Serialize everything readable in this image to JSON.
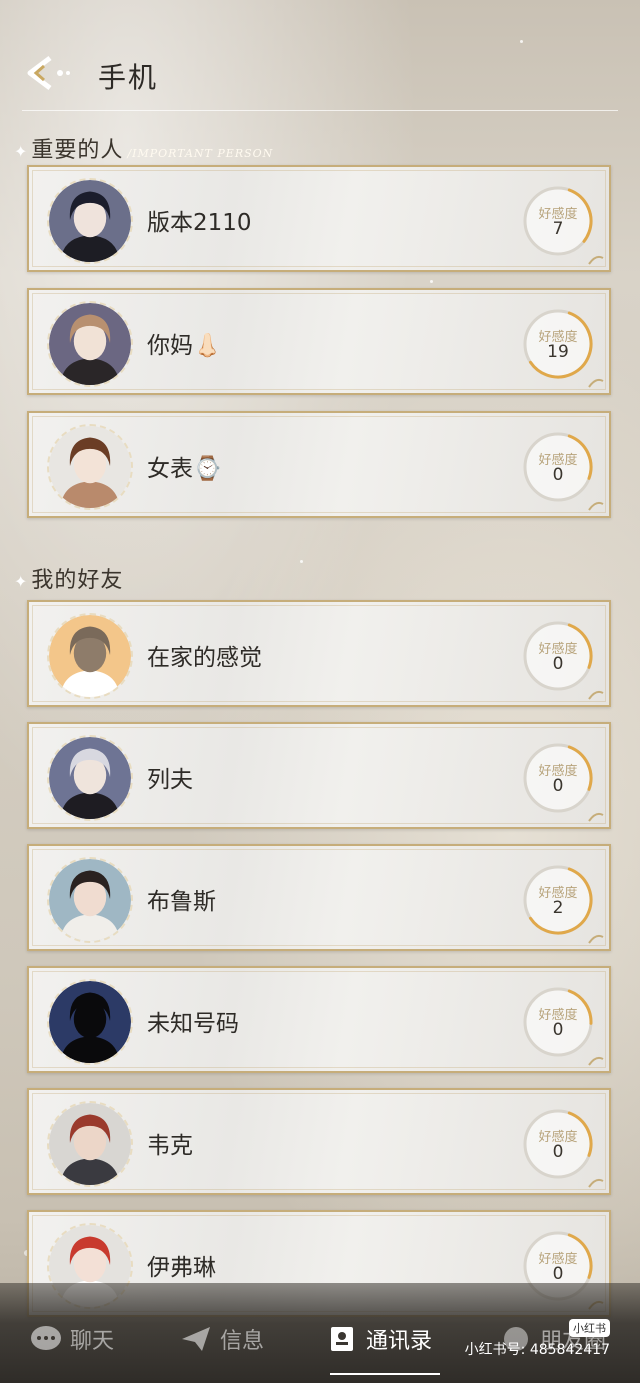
{
  "header": {
    "title": "手机"
  },
  "sections": {
    "important": {
      "title_zh": "重要的人",
      "title_en": "/IMPORTANT PERSON"
    },
    "friends": {
      "title_zh": "我的好友"
    }
  },
  "favor_label": "好感度",
  "contacts": [
    {
      "name": "版本2110",
      "favor": "7",
      "favor_fraction": 0.3,
      "avatar": "dark-haired-man",
      "section": "important"
    },
    {
      "name": "你妈👃🏻",
      "favor": "19",
      "favor_fraction": 0.6,
      "avatar": "long-haired-man",
      "section": "important"
    },
    {
      "name": "女表⌚",
      "favor": "0",
      "favor_fraction": 0.25,
      "avatar": "brown-haired-girl",
      "section": "important"
    },
    {
      "name": "在家的感觉",
      "favor": "0",
      "favor_fraction": 0.25,
      "avatar": "cat-with-sign",
      "section": "friends"
    },
    {
      "name": "列夫",
      "favor": "0",
      "favor_fraction": 0.25,
      "avatar": "silver-haired-man",
      "section": "friends"
    },
    {
      "name": "布鲁斯",
      "favor": "2",
      "favor_fraction": 0.6,
      "avatar": "dark-haired-boy",
      "section": "friends"
    },
    {
      "name": "未知号码",
      "favor": "0",
      "favor_fraction": 0.2,
      "avatar": "silhouette",
      "section": "friends"
    },
    {
      "name": "韦克",
      "favor": "0",
      "favor_fraction": 0.25,
      "avatar": "red-haired-man",
      "section": "friends"
    },
    {
      "name": "伊弗琳",
      "favor": "0",
      "favor_fraction": 0.25,
      "avatar": "red-haired-girl",
      "section": "friends"
    }
  ],
  "nav": {
    "chat": "聊天",
    "messages": "信息",
    "contacts": "通讯录",
    "moments": "朋友圈"
  },
  "watermark": {
    "badge": "小红书",
    "text": "小红书号: 485842417"
  },
  "colors": {
    "gold": "#c6ad7a",
    "favor_ring": "#e0a84a"
  }
}
